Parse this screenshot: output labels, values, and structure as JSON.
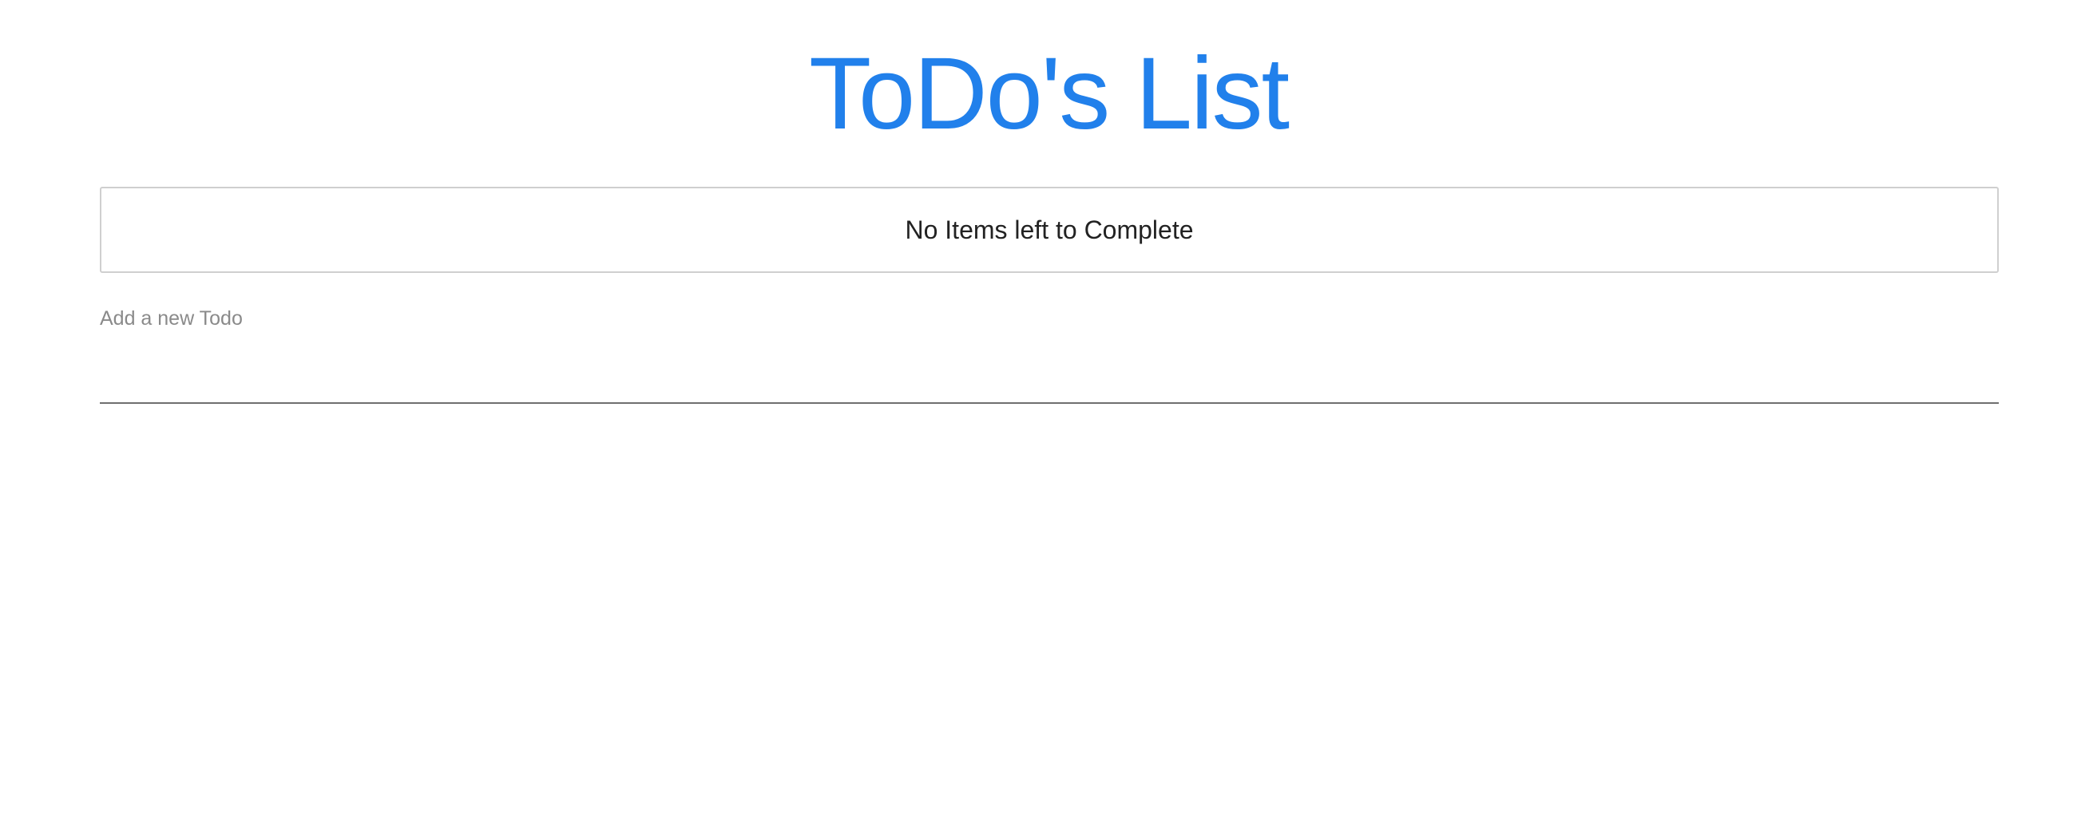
{
  "header": {
    "title": "ToDo's List"
  },
  "status": {
    "message": "No Items left to Complete"
  },
  "new_todo": {
    "label": "Add a new Todo",
    "value": ""
  },
  "colors": {
    "title": "#2180eb",
    "border": "#cfcfcf",
    "underline": "#6f6f6f",
    "label": "#8a8a8a"
  }
}
